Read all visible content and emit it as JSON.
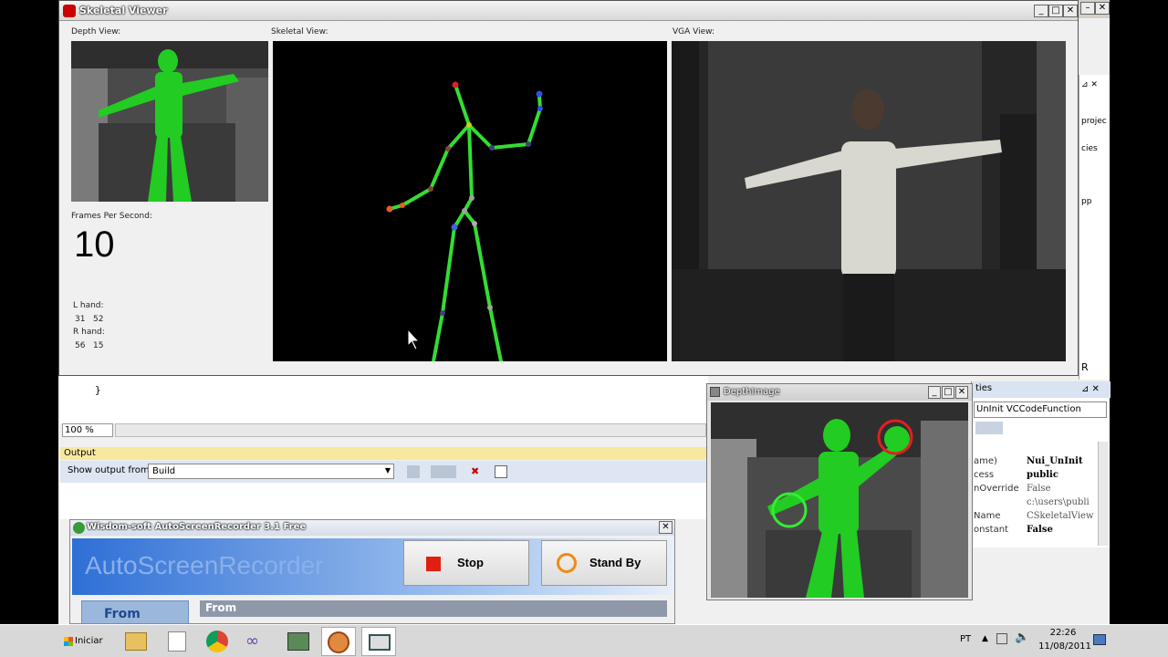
{
  "skeletal_viewer": {
    "title": "Skeletal Viewer",
    "depth_view_label": "Depth View:",
    "skeletal_view_label": "Skeletal View:",
    "vga_view_label": "VGA View:",
    "fps_label": "Frames Per Second:",
    "fps_value": "10",
    "l_hand_label": "L hand:",
    "l_hand_value": "31   52",
    "r_hand_label": "R hand:",
    "r_hand_value": "56   15"
  },
  "ide": {
    "code_brace": "}",
    "zoom": "100 %",
    "output_title": "Output",
    "show_output_from_label": "Show output from:",
    "show_output_from_value": "Build",
    "solution_snippets": [
      "projec",
      "cies",
      "pp"
    ],
    "properties": {
      "title": "ties",
      "combo": "UnInit  VCCodeFunction",
      "rows": [
        {
          "k": "ame)",
          "v": "Nui_UnInit"
        },
        {
          "k": "cess",
          "v": "public"
        },
        {
          "k": "nOverride",
          "v": "False"
        },
        {
          "k": "",
          "v": "c:\\users\\publi"
        },
        {
          "k": "Name",
          "v": "CSkeletalView"
        },
        {
          "k": "onstant",
          "v": "False"
        }
      ]
    },
    "right_letter": "R"
  },
  "depth_image": {
    "title": "DepthImage"
  },
  "recorder": {
    "title": "Wisdom-soft AutoScreenRecorder 3.1 Free",
    "logo": "AutoScreenRecorder",
    "stop_label": "Stop",
    "standby_label": "Stand By",
    "from_tab": "From",
    "from_header": "From"
  },
  "taskbar": {
    "start_label": "Iniciar",
    "lang": "PT",
    "time": "22:26",
    "date": "11/08/2011"
  },
  "colors": {
    "skeleton": "#33dd33",
    "body_mask": "#22cc22"
  }
}
